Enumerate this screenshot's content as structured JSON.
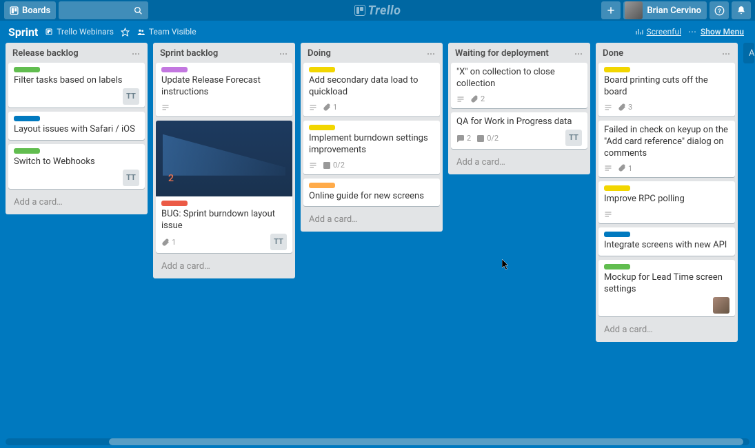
{
  "topbar": {
    "boards_label": "Boards",
    "logo_text": "Trello",
    "user_name": "Brian Cervino"
  },
  "boardbar": {
    "board_name": "Sprint",
    "team_label": "Trello Webinars",
    "visibility_label": "Team Visible",
    "powerup_label": "Screenful",
    "menu_label": "Show Menu"
  },
  "lists": [
    {
      "title": "Release backlog",
      "add_card": "Add a card…",
      "cards": [
        {
          "labels": [
            "green"
          ],
          "title": "Filter tasks based on labels",
          "member": "TT"
        },
        {
          "labels": [
            "blue"
          ],
          "title": "Layout issues with Safari / iOS"
        },
        {
          "labels": [
            "green"
          ],
          "title": "Switch to Webhooks",
          "member": "TT"
        }
      ]
    },
    {
      "title": "Sprint backlog",
      "add_card": "Add a card…",
      "cards": [
        {
          "labels": [
            "purple"
          ],
          "title": "Update Release Forecast instructions",
          "desc": true
        },
        {
          "labels": [
            "red"
          ],
          "title": "BUG: Sprint burndown layout issue",
          "attach": "1",
          "member": "TT",
          "cover": true
        }
      ]
    },
    {
      "title": "Doing",
      "add_card": "Add a card…",
      "cards": [
        {
          "labels": [
            "yellow"
          ],
          "title": "Add secondary data load to quickload",
          "desc": true,
          "attach": "1"
        },
        {
          "labels": [
            "yellow"
          ],
          "title": "Implement burndown settings improvements",
          "desc": true,
          "check": "0/2"
        },
        {
          "labels": [
            "orange"
          ],
          "title": "Online guide for new screens"
        }
      ]
    },
    {
      "title": "Waiting for deployment",
      "add_card": "Add a card…",
      "cards": [
        {
          "title": "\"X\" on collection to close collection",
          "desc": true,
          "attach": "2"
        },
        {
          "title": "QA for Work in Progress data",
          "comments": "2",
          "check": "0/2",
          "member": "TT"
        }
      ]
    },
    {
      "title": "Done",
      "add_card": "Add a card…",
      "cards": [
        {
          "labels": [
            "yellow"
          ],
          "title": "Board printing cuts off the board",
          "desc": true,
          "attach": "3"
        },
        {
          "title": "Failed in check on keyup on the \"Add card reference\" dialog on comments",
          "desc": true,
          "attach": "1"
        },
        {
          "labels": [
            "yellow"
          ],
          "title": "Improve RPC polling",
          "desc": true
        },
        {
          "labels": [
            "blue"
          ],
          "title": "Integrate screens with new API"
        },
        {
          "labels": [
            "green"
          ],
          "title": "Mockup for Lead Time screen settings",
          "member_photo": true
        }
      ]
    }
  ],
  "add_list": "Add a",
  "label_colors": {
    "green": "#61BD4F",
    "blue": "#0079BF",
    "purple": "#C377E0",
    "red": "#EB5A46",
    "yellow": "#F2D600",
    "orange": "#FFAB4A"
  }
}
